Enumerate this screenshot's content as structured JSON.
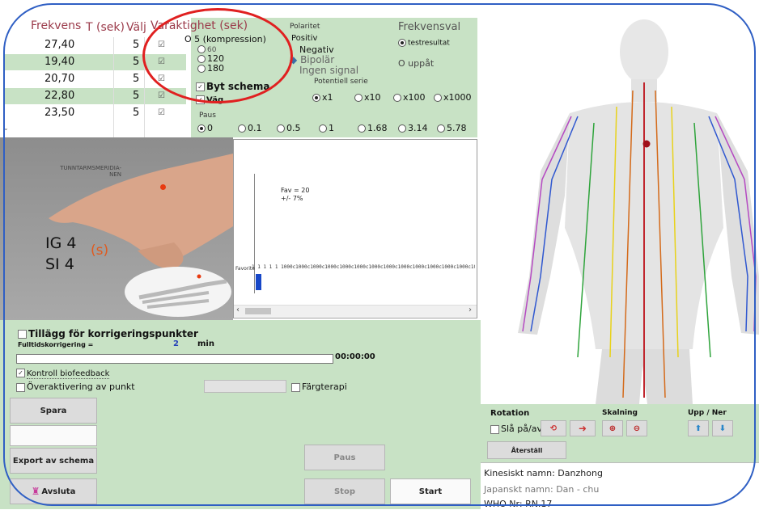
{
  "table": {
    "headers": [
      "Frekvens",
      "T (sek)",
      "Välj"
    ],
    "rows": [
      {
        "freq": "27,40",
        "t": "5",
        "sel": "☑"
      },
      {
        "freq": "19,40",
        "t": "5",
        "sel": "☑"
      },
      {
        "freq": "20,70",
        "t": "5",
        "sel": "☑"
      },
      {
        "freq": "22,80",
        "t": "5",
        "sel": "☑"
      },
      {
        "freq": "23,50",
        "t": "5",
        "sel": "☑"
      }
    ]
  },
  "duration": {
    "title": "Varaktighet (sek)",
    "options": [
      "O 5 (kompression)",
      "60",
      "120",
      "180"
    ],
    "byt_schema": "Byt schema",
    "vag": "Väg"
  },
  "polarity": {
    "title": "Polaritet",
    "options": [
      "Positiv",
      "Negativ",
      "Bipolär",
      "Ingen signal"
    ]
  },
  "freqval": {
    "title": "Frekvensval",
    "options": [
      "testresultat",
      "O uppåt"
    ]
  },
  "potential": {
    "title": "Potentiell serie",
    "options": [
      "x1",
      "x10",
      "x100",
      "x1000"
    ]
  },
  "paus": {
    "title": "Paus",
    "options": [
      "0",
      "0.1",
      "0.5",
      "1",
      "1.68",
      "3.14",
      "5.78"
    ]
  },
  "hand_image": {
    "meridian": "TUNNTARMSMERIDIA-\nNEN",
    "points": [
      "IG 4",
      "SI 4"
    ],
    "mark": "(s)"
  },
  "graph": {
    "fav": "Fav = 20",
    "pm": "+/-  7%",
    "favorite": "Favorite",
    "axis_text": "1 1 1 1 1 1000c1000c1000c1000c1000c1000c1000c1000c1000c1000c1000c1000c1000c1000c1000c1000c1000c1000c1000c1000c1000c"
  },
  "bottom": {
    "tillagg": "Tillägg för korrigeringspunkter",
    "fulltid_label": "Fulltidskorrigering =",
    "fulltid_value": "2",
    "fulltid_unit": "min",
    "timer": "00:00:00",
    "kontroll": "Kontroll biofeedback",
    "overaktivering": "Överaktivering av punkt",
    "fargterapi": "Färgterapi",
    "spara": "Spara",
    "export": "Export av schema",
    "avsluta": "Avsluta",
    "paus": "Paus",
    "stop": "Stop",
    "start": "Start"
  },
  "rotation": {
    "title": "Rotation",
    "sla": "Slå på/av",
    "skalning": "Skalning",
    "upp_ner": "Upp / Ner",
    "aterstall": "Återställ"
  },
  "info": {
    "kinesiskt": "Kinesiskt namn: Danzhong",
    "japanskt": "Japanskt namn: Dan - chu",
    "who": "WHO Nr: RN.17"
  },
  "colors": {
    "panel_green": "#c8e2c5",
    "annotation_red": "#e02020",
    "frame_blue": "#2f5fc4"
  }
}
